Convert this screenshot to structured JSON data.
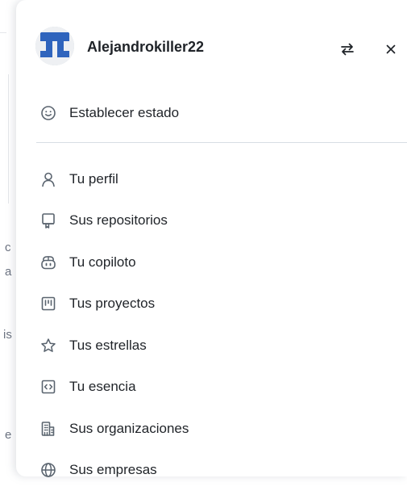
{
  "backdrop": {
    "fragments": [
      "c",
      "a",
      "is",
      "e"
    ]
  },
  "account": {
    "username": "Alejandrokiller22",
    "avatar_icon": "identicon-avatar",
    "avatar_color": "#2f64bd"
  },
  "header_actions": {
    "switch_icon": "switch-account-icon",
    "close_icon": "close-icon"
  },
  "status": {
    "label": "Establecer estado",
    "icon": "smiley-icon"
  },
  "menu": {
    "items": [
      {
        "label": "Tu perfil",
        "icon": "person-icon"
      },
      {
        "label": "Sus repositorios",
        "icon": "repo-icon"
      },
      {
        "label": "Tu copiloto",
        "icon": "copilot-icon"
      },
      {
        "label": "Tus proyectos",
        "icon": "project-icon"
      },
      {
        "label": "Tus estrellas",
        "icon": "star-icon"
      },
      {
        "label": "Tu esencia",
        "icon": "gist-icon"
      },
      {
        "label": "Sus organizaciones",
        "icon": "organization-icon"
      },
      {
        "label": "Sus empresas",
        "icon": "globe-icon"
      }
    ]
  },
  "colors": {
    "text": "#1f2328",
    "icon": "#59636e",
    "divider": "#d8dee4"
  }
}
